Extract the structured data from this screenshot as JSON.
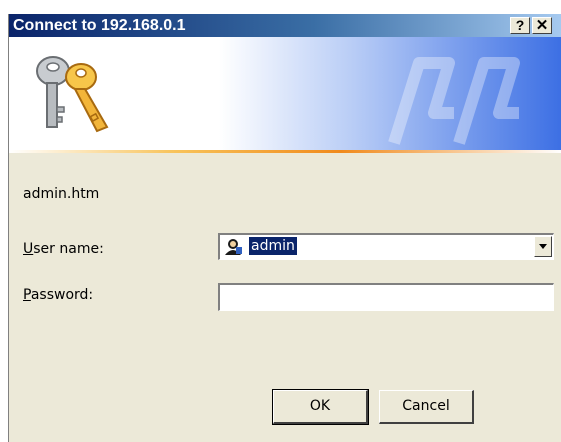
{
  "window": {
    "title": "Connect to 192.168.0.1",
    "help_label": "?",
    "close_label": "✕"
  },
  "form": {
    "url_text": "admin.htm",
    "username_label_accel": "U",
    "username_label_rest": "ser name:",
    "username_value": "admin",
    "password_label_accel": "P",
    "password_label_rest": "assword:",
    "password_value": ""
  },
  "buttons": {
    "ok_label": "OK",
    "cancel_label": "Cancel"
  },
  "icons": {
    "banner": "keys-icon",
    "user": "user-icon",
    "dropdown": "chevron-down-icon"
  },
  "colors": {
    "title_start": "#0a246a",
    "title_end": "#a6caf0",
    "selection": "#0a246a",
    "window_bg": "#ece9d8"
  }
}
